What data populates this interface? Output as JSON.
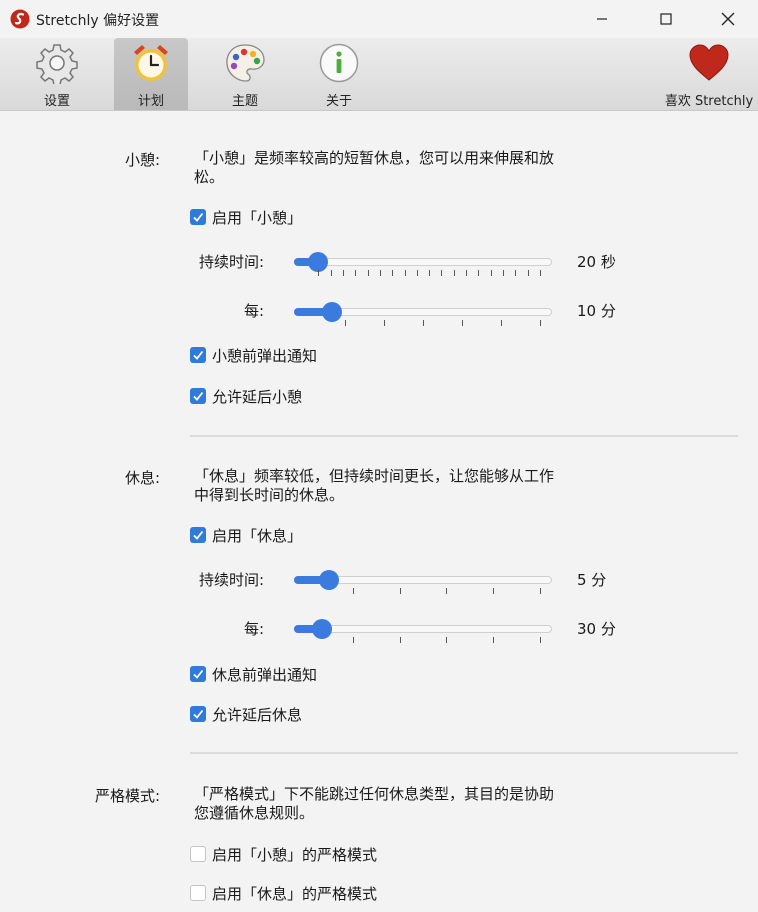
{
  "window": {
    "title": "Stretchly 偏好设置"
  },
  "toolbar": {
    "settings": "设置",
    "schedule": "计划",
    "theme": "主题",
    "about": "关于",
    "love": "喜欢 Stretchly"
  },
  "microbreak": {
    "label": "小憩:",
    "description": "「小憩」是频率较高的短暂休息，您可以用来伸展和放松。",
    "enable": "启用「小憩」",
    "duration_label": "持续时间:",
    "duration_value": "20 秒",
    "duration_fraction": 0.05,
    "interval_label": "每:",
    "interval_value": "10 分",
    "interval_fraction": 0.11,
    "notify": "小憩前弹出通知",
    "postpone": "允许延后小憩"
  },
  "break": {
    "label": "休息:",
    "description": "「休息」频率较低，但持续时间更长，让您能够从工作中得到长时间的休息。",
    "enable": "启用「休息」",
    "duration_label": "持续时间:",
    "duration_value": "5 分",
    "duration_fraction": 0.1,
    "interval_label": "每:",
    "interval_value": "30 分",
    "interval_fraction": 0.07,
    "notify": "休息前弹出通知",
    "postpone": "允许延后休息"
  },
  "strict": {
    "label": "严格模式:",
    "description": "「严格模式」下不能跳过任何休息类型，其目的是协助您遵循休息规则。",
    "microbreak_strict": "启用「小憩」的严格模式",
    "break_strict": "启用「休息」的严格模式"
  },
  "colors": {
    "accent": "#3b7be0",
    "checkbox": "#2f7bd9",
    "heart": "#c0281c"
  }
}
